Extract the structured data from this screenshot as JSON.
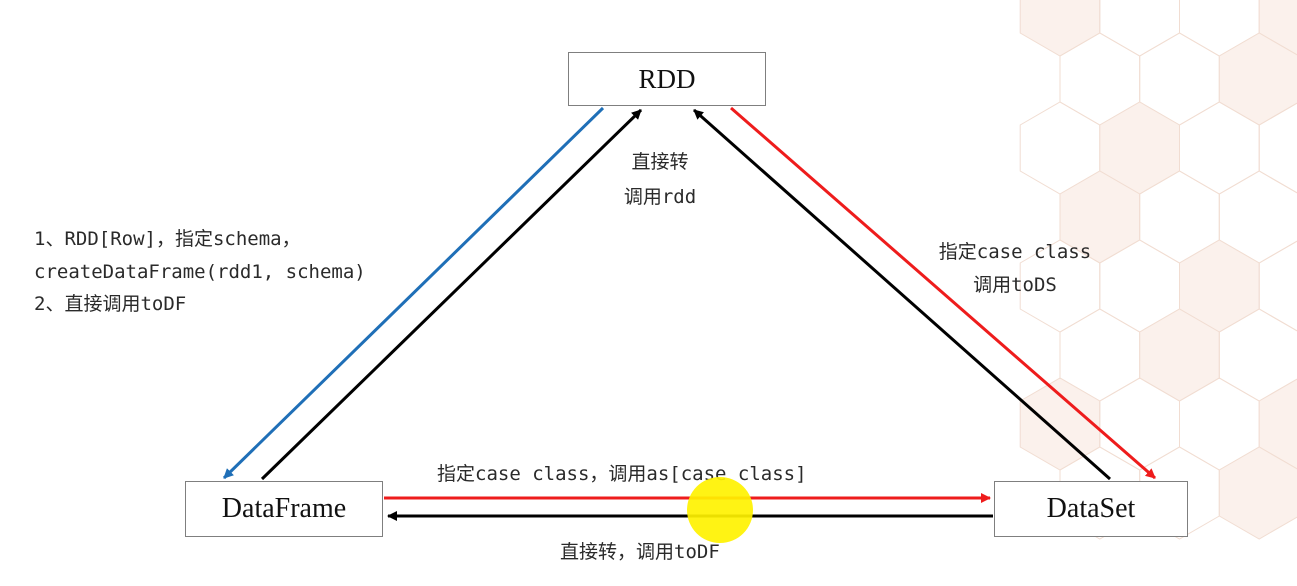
{
  "colors": {
    "to_rdd_arrow": "#000000",
    "rdd_to_df_arrow": "#1f6fb7",
    "to_ds_arrow": "#ee1c1c",
    "ds_to_df_arrow": "#000000",
    "cursor_highlight": "#fff200",
    "background_hex_pattern": "#f6e5dc"
  },
  "nodes": {
    "rdd": "RDD",
    "dataframe": "DataFrame",
    "dataset": "DataSet"
  },
  "edges": {
    "rdd_to_dataframe": {
      "line1": "1、RDD[Row]，指定schema，",
      "line2": "createDataFrame(rdd1, schema)",
      "line3": "2、直接调用toDF"
    },
    "dataframe_to_rdd": {
      "line1": "直接转",
      "line2": "调用rdd"
    },
    "rdd_to_dataset": {
      "line1": "指定case class",
      "line2": "调用toDS"
    },
    "dataframe_to_dataset": "指定case class，调用as[case class]",
    "dataset_to_dataframe": "直接转，调用toDF"
  },
  "icons": {
    "cursor": "cursor-highlight-icon"
  }
}
